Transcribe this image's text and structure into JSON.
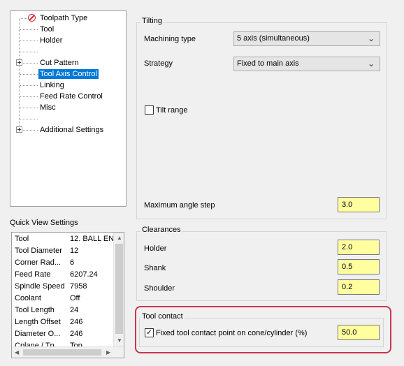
{
  "tree": {
    "items": [
      {
        "label": "Toolpath Type",
        "icon": "no-entry-icon"
      },
      {
        "label": "Tool"
      },
      {
        "label": "Holder"
      },
      {
        "label": "Cut Pattern",
        "expandable": true
      },
      {
        "label": "Tool Axis Control",
        "selected": true
      },
      {
        "label": "Linking"
      },
      {
        "label": "Feed Rate Control"
      },
      {
        "label": "Misc"
      },
      {
        "label": "Additional Settings",
        "expandable": true
      }
    ]
  },
  "quick_view": {
    "title": "Quick View Settings",
    "rows": [
      {
        "key": "Tool",
        "value": "12. BALL EN"
      },
      {
        "key": "Tool Diameter",
        "value": "12"
      },
      {
        "key": "Corner Rad...",
        "value": "6"
      },
      {
        "key": "Feed Rate",
        "value": "6207.24"
      },
      {
        "key": "Spindle Speed",
        "value": "7958"
      },
      {
        "key": "Coolant",
        "value": "Off"
      },
      {
        "key": "Tool Length",
        "value": "24"
      },
      {
        "key": "Length Offset",
        "value": "246"
      },
      {
        "key": "Diameter O...",
        "value": "246"
      },
      {
        "key": "Cplane / Tp...",
        "value": "Top"
      }
    ]
  },
  "tilting": {
    "title": "Tilting",
    "machining_type_label": "Machining type",
    "machining_type_value": "5 axis (simultaneous)",
    "strategy_label": "Strategy",
    "strategy_value": "Fixed to main axis",
    "tilt_range_label": "Tilt range",
    "tilt_range_checked": false,
    "max_angle_label": "Maximum angle step",
    "max_angle_value": "3.0"
  },
  "clearances": {
    "title": "Clearances",
    "holder_label": "Holder",
    "holder_value": "2.0",
    "shank_label": "Shank",
    "shank_value": "0.5",
    "shoulder_label": "Shoulder",
    "shoulder_value": "0.2"
  },
  "tool_contact": {
    "title": "Tool contact",
    "fixed_label": "Fixed tool contact point on cone/cylinder (%)",
    "fixed_checked": true,
    "fixed_value": "50.0"
  },
  "colors": {
    "selection": "#0078d7",
    "field_background": "#ffffa0",
    "highlight_border": "#c8364f",
    "no_entry_icon": "#d9262c"
  }
}
